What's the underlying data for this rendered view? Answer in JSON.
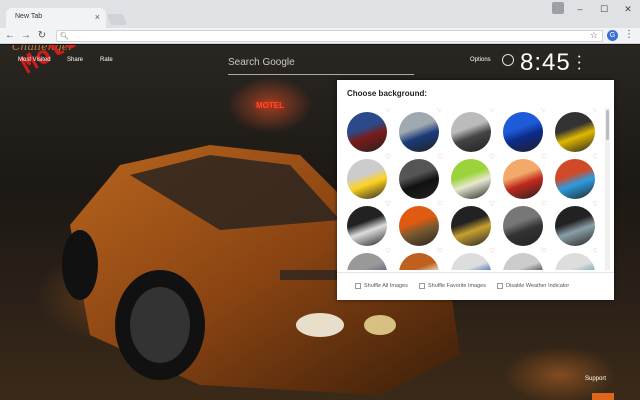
{
  "browser": {
    "tab_title": "New Tab",
    "tab_close": "×",
    "window": {
      "minimize": "–",
      "maximize": "☐",
      "close": "✕"
    },
    "ext_label": "G"
  },
  "watermark": "MotoBros",
  "logo_script": "Challenger",
  "motel_sign": "MOTEL",
  "nav": {
    "most_visited": "Most Visited",
    "share": "Share",
    "rate": "Rate"
  },
  "search": {
    "placeholder": "Search Google"
  },
  "options": "Options",
  "clock": {
    "time": "8:45"
  },
  "support": "Support",
  "panel": {
    "title": "Choose background:",
    "thumbnails": [
      {
        "c1": "#7a1a1a",
        "c2": "#2a4a8a"
      },
      {
        "c1": "#1a3b7a",
        "c2": "#a0a8b0"
      },
      {
        "c1": "#444",
        "c2": "#bbb"
      },
      {
        "c1": "#0b2a8a",
        "c2": "#1e5bd8"
      },
      {
        "c1": "#e0b800",
        "c2": "#333"
      },
      {
        "c1": "#ffd21f",
        "c2": "#ccc"
      },
      {
        "c1": "#111",
        "c2": "#555"
      },
      {
        "c1": "#e8e8d0",
        "c2": "#9bd33b"
      },
      {
        "c1": "#c0281c",
        "c2": "#f2a96a"
      },
      {
        "c1": "#2b9de0",
        "c2": "#d04a2a"
      },
      {
        "c1": "#ddd",
        "c2": "#222"
      },
      {
        "c1": "#7a5a30",
        "c2": "#e05a10"
      },
      {
        "c1": "#c8a030",
        "c2": "#222"
      },
      {
        "c1": "#333",
        "c2": "#777"
      },
      {
        "c1": "#8aa0a8",
        "c2": "#222"
      },
      {
        "c1": "#668",
        "c2": "#999"
      },
      {
        "c1": "#e8e0d0",
        "c2": "#c06020"
      },
      {
        "c1": "#4a70c0",
        "c2": "#ddd"
      },
      {
        "c1": "#555",
        "c2": "#ccc"
      },
      {
        "c1": "#7ab",
        "c2": "#ddd"
      }
    ],
    "shuffle_all": "Shuffle All Images",
    "shuffle_fav": "Shuffle Favorite Images",
    "disable_weather": "Disable Weather Indicator"
  }
}
